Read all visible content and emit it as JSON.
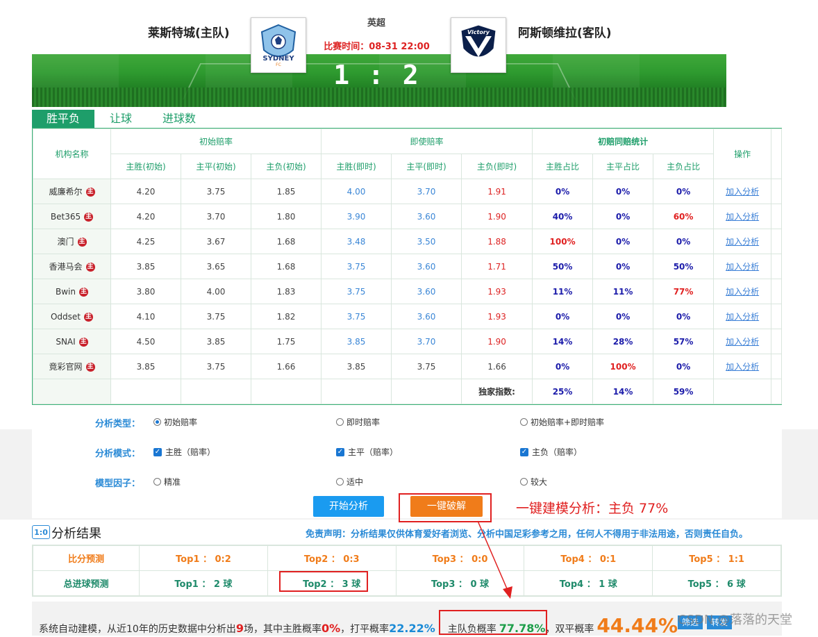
{
  "match": {
    "league": "英超",
    "home_team": "莱斯特城(主队)",
    "away_team": "阿斯顿维拉(客队)",
    "time_label": "比赛时间：08-31 22:00",
    "score": "1 : 2",
    "home_logo_text": "SYDNEY",
    "home_logo_sub": "FC",
    "away_logo_text": "Victory"
  },
  "tabs": [
    "胜平负",
    "让球",
    "进球数"
  ],
  "odds_table": {
    "col_institution": "机构名称",
    "group_initial": "初始赔率",
    "group_current": "即使赔率",
    "group_stats": "初赔同赔统计",
    "col_action": "操作",
    "sub_headers": [
      "主胜(初始)",
      "主平(初始)",
      "主负(初始)",
      "主胜(即时)",
      "主平(即时)",
      "主负(即时)",
      "主胜占比",
      "主平占比",
      "主负占比"
    ],
    "rows": [
      {
        "name": "威廉希尔",
        "badge": "主",
        "init": [
          "4.20",
          "3.75",
          "1.85"
        ],
        "cur": [
          "4.00",
          "3.70",
          "1.91"
        ],
        "pct": [
          "0%",
          "0%",
          "0%"
        ],
        "action": "加入分析"
      },
      {
        "name": "Bet365",
        "badge": "主",
        "init": [
          "4.20",
          "3.70",
          "1.80"
        ],
        "cur": [
          "3.90",
          "3.60",
          "1.90"
        ],
        "pct": [
          "40%",
          "0%",
          "60%"
        ],
        "action": "加入分析"
      },
      {
        "name": "澳门",
        "badge": "主",
        "init": [
          "4.25",
          "3.67",
          "1.68"
        ],
        "cur": [
          "3.48",
          "3.50",
          "1.88"
        ],
        "pct": [
          "100%",
          "0%",
          "0%"
        ],
        "action": "加入分析"
      },
      {
        "name": "香港马会",
        "badge": "主",
        "init": [
          "3.85",
          "3.65",
          "1.68"
        ],
        "cur": [
          "3.75",
          "3.60",
          "1.71"
        ],
        "pct": [
          "50%",
          "0%",
          "50%"
        ],
        "action": "加入分析"
      },
      {
        "name": "Bwin",
        "badge": "主",
        "init": [
          "3.80",
          "4.00",
          "1.83"
        ],
        "cur": [
          "3.75",
          "3.60",
          "1.93"
        ],
        "pct": [
          "11%",
          "11%",
          "77%"
        ],
        "action": "加入分析"
      },
      {
        "name": "Oddset",
        "badge": "主",
        "init": [
          "4.10",
          "3.75",
          "1.82"
        ],
        "cur": [
          "3.75",
          "3.60",
          "1.93"
        ],
        "pct": [
          "0%",
          "0%",
          "0%"
        ],
        "action": "加入分析"
      },
      {
        "name": "SNAI",
        "badge": "主",
        "init": [
          "4.50",
          "3.85",
          "1.75"
        ],
        "cur": [
          "3.85",
          "3.70",
          "1.90"
        ],
        "pct": [
          "14%",
          "28%",
          "57%"
        ],
        "action": "加入分析"
      },
      {
        "name": "竟彩官网",
        "badge": "主",
        "init": [
          "3.85",
          "3.75",
          "1.66"
        ],
        "cur": [
          "3.85",
          "3.75",
          "1.66"
        ],
        "pct": [
          "0%",
          "100%",
          "0%"
        ],
        "action": "加入分析"
      }
    ],
    "exclusive_label": "独家指数:",
    "exclusive_pct": [
      "25%",
      "14%",
      "59%"
    ]
  },
  "analysis": {
    "type_label": "分析类型：",
    "type_options": [
      "初始赔率",
      "即时赔率",
      "初始赔率+即时赔率"
    ],
    "mode_label": "分析模式：",
    "mode_options": [
      "主胜（赔率）",
      "主平（赔率）",
      "主负（赔率）"
    ],
    "factor_label": "模型因子：",
    "factor_options": [
      "精准",
      "适中",
      "较大"
    ],
    "start_button": "开始分析",
    "crack_button": "一键破解",
    "annotation": "一键建模分析：主负 77%"
  },
  "results": {
    "icon_text": "1:0",
    "title": "分析结果",
    "disclaimer": "免责声明：分析结果仅供体育爱好者浏览、分析中国足彩参考之用，任何人不得用于非法用途，否则责任自负。",
    "score_label": "比分预测",
    "score_preds": [
      "Top1 ： 0:2",
      "Top2 ： 0:3",
      "Top3 ： 0:0",
      "Top4 ： 0:1",
      "Top5 ： 1:1"
    ],
    "goals_label": "总进球预测",
    "goals_preds": [
      "Top1 ： 2 球",
      "Top2 ： 3 球",
      "Top3 ： 0 球",
      "Top4 ： 1 球",
      "Top5 ： 6 球"
    ]
  },
  "summary": {
    "prefix": "系统自动建模，从近10年的历史数据中分析出",
    "matches": "9",
    "matches_unit": "场，其中主胜概率",
    "home_win": "0%",
    "draw_label": "，打平概率",
    "draw": "22.22%",
    "lose_label": "主队负概率",
    "lose": "77.78%",
    "double_label": "，双平概率",
    "double": "44.44%",
    "btn1": "筛选",
    "btn2": "转发",
    "watermark": "CSDN @落落的天堂"
  }
}
